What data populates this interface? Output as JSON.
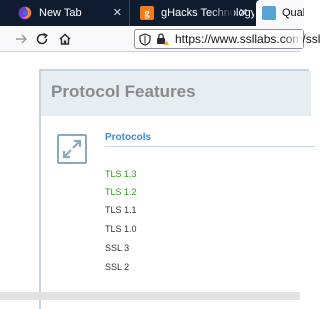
{
  "tabs": [
    {
      "title": "New Tab",
      "icon": "firefox-icon",
      "active": false
    },
    {
      "title": "gHacks Technology N",
      "icon": "ghacks-favicon",
      "active": false
    },
    {
      "title": "Qualy",
      "icon": "ssllabs-favicon",
      "active": true
    }
  ],
  "navbar": {
    "url": "https://www.ssllabs.com/ssltes"
  },
  "page": {
    "section_title": "Protocol Features",
    "column_header": "Protocols",
    "protocols": [
      {
        "name": "TLS 1.3",
        "status": "enabled"
      },
      {
        "name": "TLS 1.2",
        "status": "enabled"
      },
      {
        "name": "TLS 1.1",
        "status": "neutral"
      },
      {
        "name": "TLS 1.0",
        "status": "neutral"
      },
      {
        "name": "SSL 3",
        "status": "neutral"
      },
      {
        "name": "SSL 2",
        "status": "neutral"
      }
    ]
  },
  "status_bar": {
    "text": ""
  },
  "colors": {
    "tabbar_bg": "#0f1b2e",
    "panel_header_bg": "#e6eef1",
    "link_blue": "#3a8ed0",
    "enabled_green": "#2a9b1a"
  }
}
